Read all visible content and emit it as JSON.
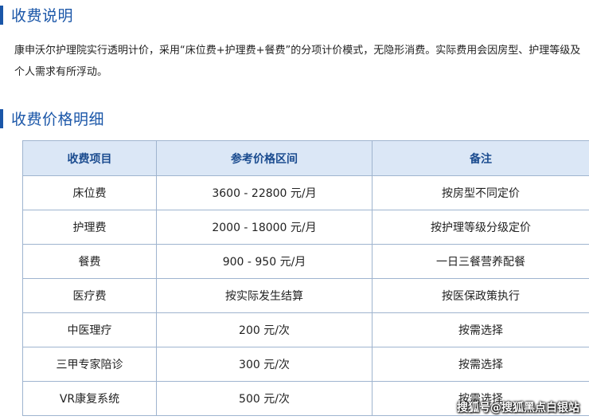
{
  "section1": {
    "title": "收费说明"
  },
  "intro": {
    "text": "康申沃尔护理院实行透明计价，采用“床位费+护理费+餐费”的分项计价模式，无隐形消费。实际费用会因房型、护理等级及个人需求有所浮动。"
  },
  "section2": {
    "title": "收费价格明细"
  },
  "table": {
    "headers": [
      "收费项目",
      "参考价格区间",
      "备注"
    ],
    "rows": [
      [
        "床位费",
        "3600 - 22800 元/月",
        "按房型不同定价"
      ],
      [
        "护理费",
        "2000 - 18000 元/月",
        "按护理等级分级定价"
      ],
      [
        "餐费",
        "900 - 950 元/月",
        "一日三餐营养配餐"
      ],
      [
        "医疗费",
        "按实际发生结算",
        "按医保政策执行"
      ],
      [
        "中医理疗",
        "200 元/次",
        "按需选择"
      ],
      [
        "三甲专家陪诊",
        "300 元/次",
        "按需选择"
      ],
      [
        "VR康复系统",
        "500 元/次",
        "按需选择"
      ]
    ]
  },
  "watermark": "搜狐号@搜狐黑点白银站",
  "colors": {
    "accent": "#1a56a8",
    "header_bg": "#dbe7f6",
    "border": "#9fb4cf"
  }
}
